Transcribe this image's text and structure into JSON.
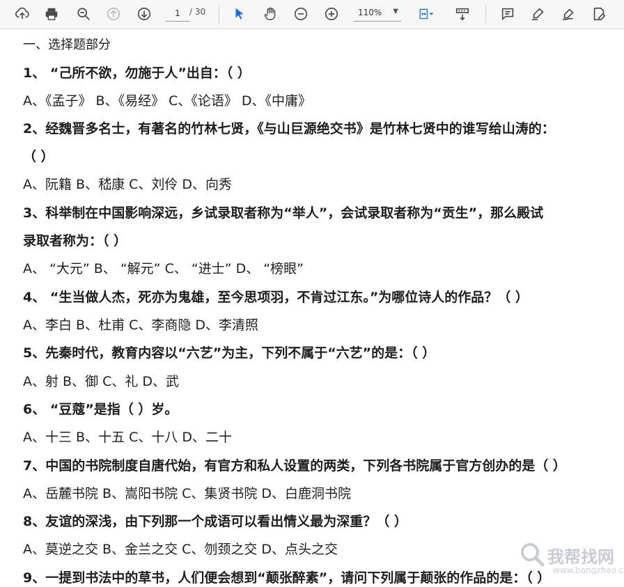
{
  "toolbar": {
    "page_current": "1",
    "page_total": "/ 30",
    "zoom": "110%",
    "icons": [
      "upload-icon",
      "print-icon",
      "zoom-search-icon",
      "page-up-icon",
      "page-down-icon",
      "select-cursor-icon",
      "hand-icon",
      "zoom-out-icon",
      "zoom-in-icon",
      "fit-page-icon",
      "scroll-mode-icon",
      "comment-icon",
      "highlight-icon",
      "sign-icon",
      "edit-icon"
    ]
  },
  "document": {
    "lines": [
      {
        "text": "一、选择题部分",
        "kind": "section"
      },
      {
        "text": "1、  “己所不欲，勿施于人”出自：（        ）",
        "kind": "question"
      },
      {
        "text": "A、《孟子》  B、《易经》  C、《论语》  D、《中庸》",
        "kind": "option"
      },
      {
        "text": "2、经魏晋多名士，有著名的竹林七贤，《与山巨源绝交书》是竹林七贤中的谁写给山涛的：",
        "kind": "question"
      },
      {
        "text": "（          ）",
        "kind": "question"
      },
      {
        "text": "A、阮籍   B、嵇康   C、刘伶   D、向秀",
        "kind": "option"
      },
      {
        "text": "3、科举制在中国影响深远，乡试录取者称为“举人”，会试录取者称为“贡生”，那么殿试",
        "kind": "question"
      },
      {
        "text": "录取者称为：（        ）",
        "kind": "question"
      },
      {
        "text": "A、  “大元”    B、  “解元”    C、  “进士”    D、  “榜眼”",
        "kind": "option"
      },
      {
        "text": "4、  “生当做人杰，死亦为鬼雄，至今思项羽，不肯过江东。”为哪位诗人的作品？（      ）",
        "kind": "question"
      },
      {
        "text": "A、李白   B、杜甫   C、李商隐  D、李清照",
        "kind": "option"
      },
      {
        "text": "5、先秦时代，教育内容以“六艺”为主，下列不属于“六艺”的是：（        ）",
        "kind": "question"
      },
      {
        "text": "A、射   B、御  C、礼  D、武",
        "kind": "option"
      },
      {
        "text": "6、  “豆蔻”是指（        ）岁。",
        "kind": "question"
      },
      {
        "text": "A、十三    B、十五   C、十八    D、二十",
        "kind": "option"
      },
      {
        "text": "7、中国的书院制度自唐代始，有官方和私人设置的两类，下列各书院属于官方创办的是（        ）",
        "kind": "question"
      },
      {
        "text": "A、岳麓书院  B、嵩阳书院  C、集贤书院  D、白鹿洞书院",
        "kind": "option"
      },
      {
        "text": "8、友谊的深浅，由下列那一个成语可以看出情义最为深重？（          ）",
        "kind": "question"
      },
      {
        "text": "A、莫逆之交     B、金兰之交     C、刎颈之交      D、点头之交",
        "kind": "option"
      },
      {
        "text": "9、一提到书法中的草书，人们便会想到“颠张醉素”，请问下列属于颠张的作品的是：（        ）",
        "kind": "question"
      }
    ]
  },
  "watermark": {
    "text_cn": "我帮找网",
    "text_en": "www.bangzhao.com"
  }
}
